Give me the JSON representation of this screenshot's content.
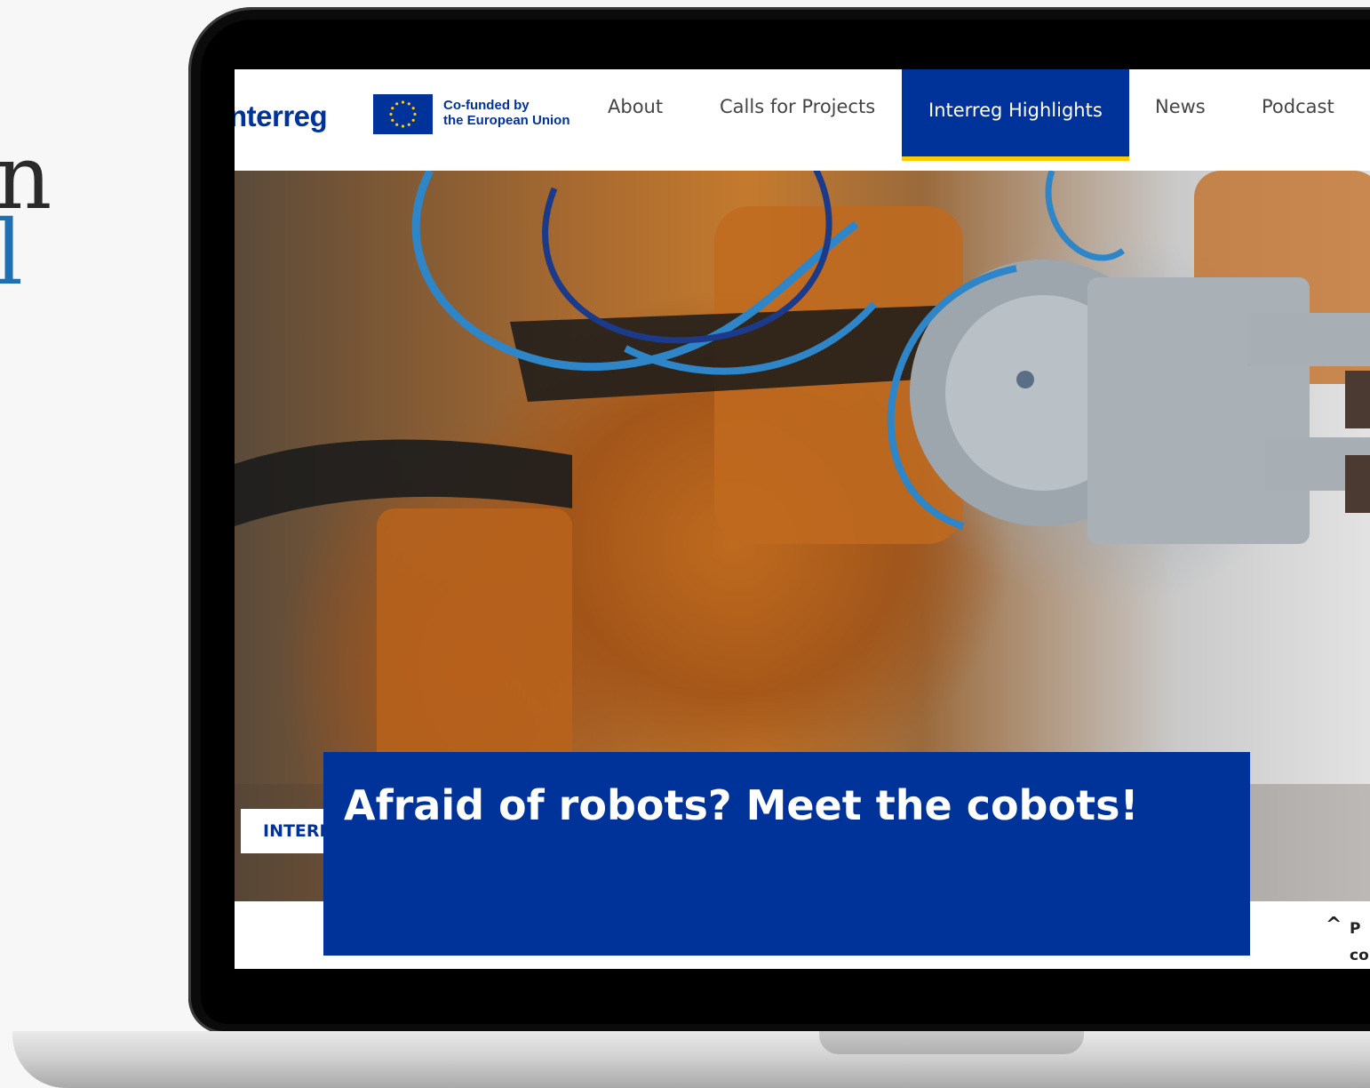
{
  "left_fragments": [
    "n",
    "l"
  ],
  "site": {
    "logo_text": "nterreg",
    "cofunded_line1": "Co-funded by",
    "cofunded_line2": "the European Union"
  },
  "nav": {
    "items": [
      {
        "label": "About"
      },
      {
        "label": "Calls for Projects"
      },
      {
        "label": "Interreg Highlights",
        "active": true
      },
      {
        "label": "News"
      },
      {
        "label": "Podcast"
      }
    ]
  },
  "hero": {
    "tag": "INTERREG HIGHLIGHTS",
    "title": "Afraid of robots? Meet the cobots!"
  },
  "back_to_top": {
    "line1": "P",
    "line2": "co"
  },
  "colors": {
    "brand_blue": "#003399",
    "accent_yellow": "#ffcc00"
  }
}
